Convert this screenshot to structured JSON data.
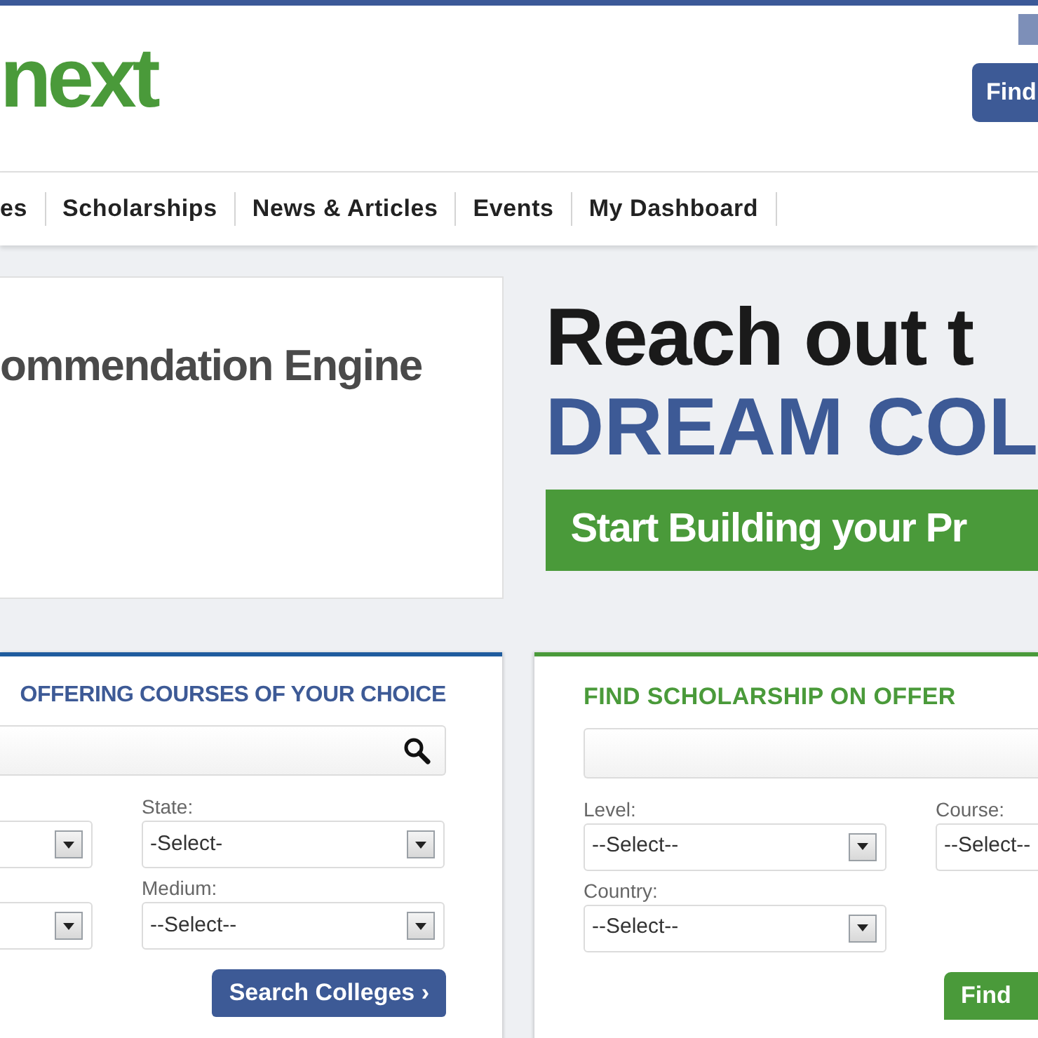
{
  "header": {
    "logo": "next",
    "find_button": "Find"
  },
  "nav": [
    {
      "label": "es"
    },
    {
      "label": "Scholarships"
    },
    {
      "label": "News & Articles"
    },
    {
      "label": "Events"
    },
    {
      "label": "My Dashboard"
    }
  ],
  "banner_left": {
    "text": "ommendation Engine"
  },
  "banner_right": {
    "line_1": "Reach out t",
    "line_2": "DREAM COL",
    "cta": "Start Building your Pr"
  },
  "college_search": {
    "title": "OFFERING COURSES OF YOUR CHOICE",
    "fields": [
      {
        "kind": "select_cut"
      },
      {
        "kind": "select",
        "label": "State:",
        "value": "-Select-"
      },
      {
        "kind": "select_cut"
      },
      {
        "kind": "select",
        "label": "Medium:",
        "value": "--Select--"
      }
    ],
    "button": "Search Colleges ›"
  },
  "scholarship_search": {
    "title": "FIND SCHOLARSHIP ON OFFER",
    "fields": [
      {
        "kind": "select",
        "label": "Level:",
        "value": "--Select--"
      },
      {
        "kind": "select_open_end",
        "label": "Course:",
        "value": "--Select--"
      },
      {
        "kind": "select",
        "label": "Country:",
        "value": "--Select--"
      }
    ],
    "button": "Find"
  }
}
